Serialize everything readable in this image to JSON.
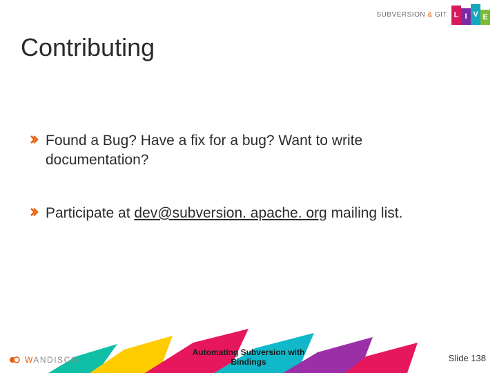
{
  "header": {
    "brand_left": "SUBVERSION",
    "brand_amp": "&",
    "brand_right": "GIT",
    "live_letters": [
      "L",
      "I",
      "V",
      "E"
    ]
  },
  "title": "Contributing",
  "bullets": [
    {
      "text": "Found a Bug?  Have a fix for a bug? Want to write documentation?"
    },
    {
      "prefix": "Participate at ",
      "link": "dev@subversion. apache. org",
      "suffix": " mailing list."
    }
  ],
  "footer": {
    "title_line1": "Automating Subversion with",
    "title_line2": "Bindings",
    "slide_label": "Slide 138",
    "wd_letter": "W",
    "wd_rest": "ANDISCO"
  }
}
